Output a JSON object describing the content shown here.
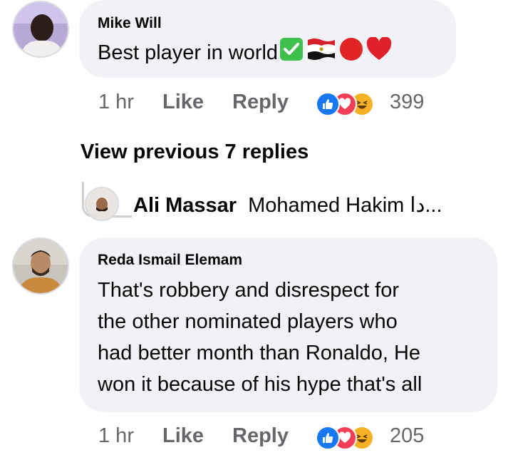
{
  "comments": [
    {
      "author": "Mike Will",
      "text": "Best player in world",
      "emoji_icons": [
        "check-mark-button-icon",
        "egypt-flag-icon",
        "red-circle-icon",
        "red-heart-icon"
      ],
      "time": "1 hr",
      "like_label": "Like",
      "reply_label": "Reply",
      "reaction_icons": [
        "like-icon",
        "love-icon",
        "haha-icon"
      ],
      "reaction_count": "399"
    },
    {
      "author": "Reda Ismail Elemam",
      "text_lines": [
        "That's robbery and disrespect for",
        "the other nominated players who",
        "had better month than Ronaldo, He",
        "won it because of his hype that's all"
      ],
      "time": "1 hr",
      "like_label": "Like",
      "reply_label": "Reply",
      "reaction_icons": [
        "like-icon",
        "love-icon",
        "haha-icon"
      ],
      "reaction_count": "205"
    }
  ],
  "view_previous": "View previous 7 replies",
  "reply_preview": {
    "author": "Ali Massar",
    "snippet": "Mohamed Hakim دا..."
  },
  "colors": {
    "bubble": "#f0f2f5",
    "meta_text": "#65676b",
    "like_blue": "#1877f2",
    "love_red": "#f33e58",
    "haha_yellow": "#f7b125"
  }
}
